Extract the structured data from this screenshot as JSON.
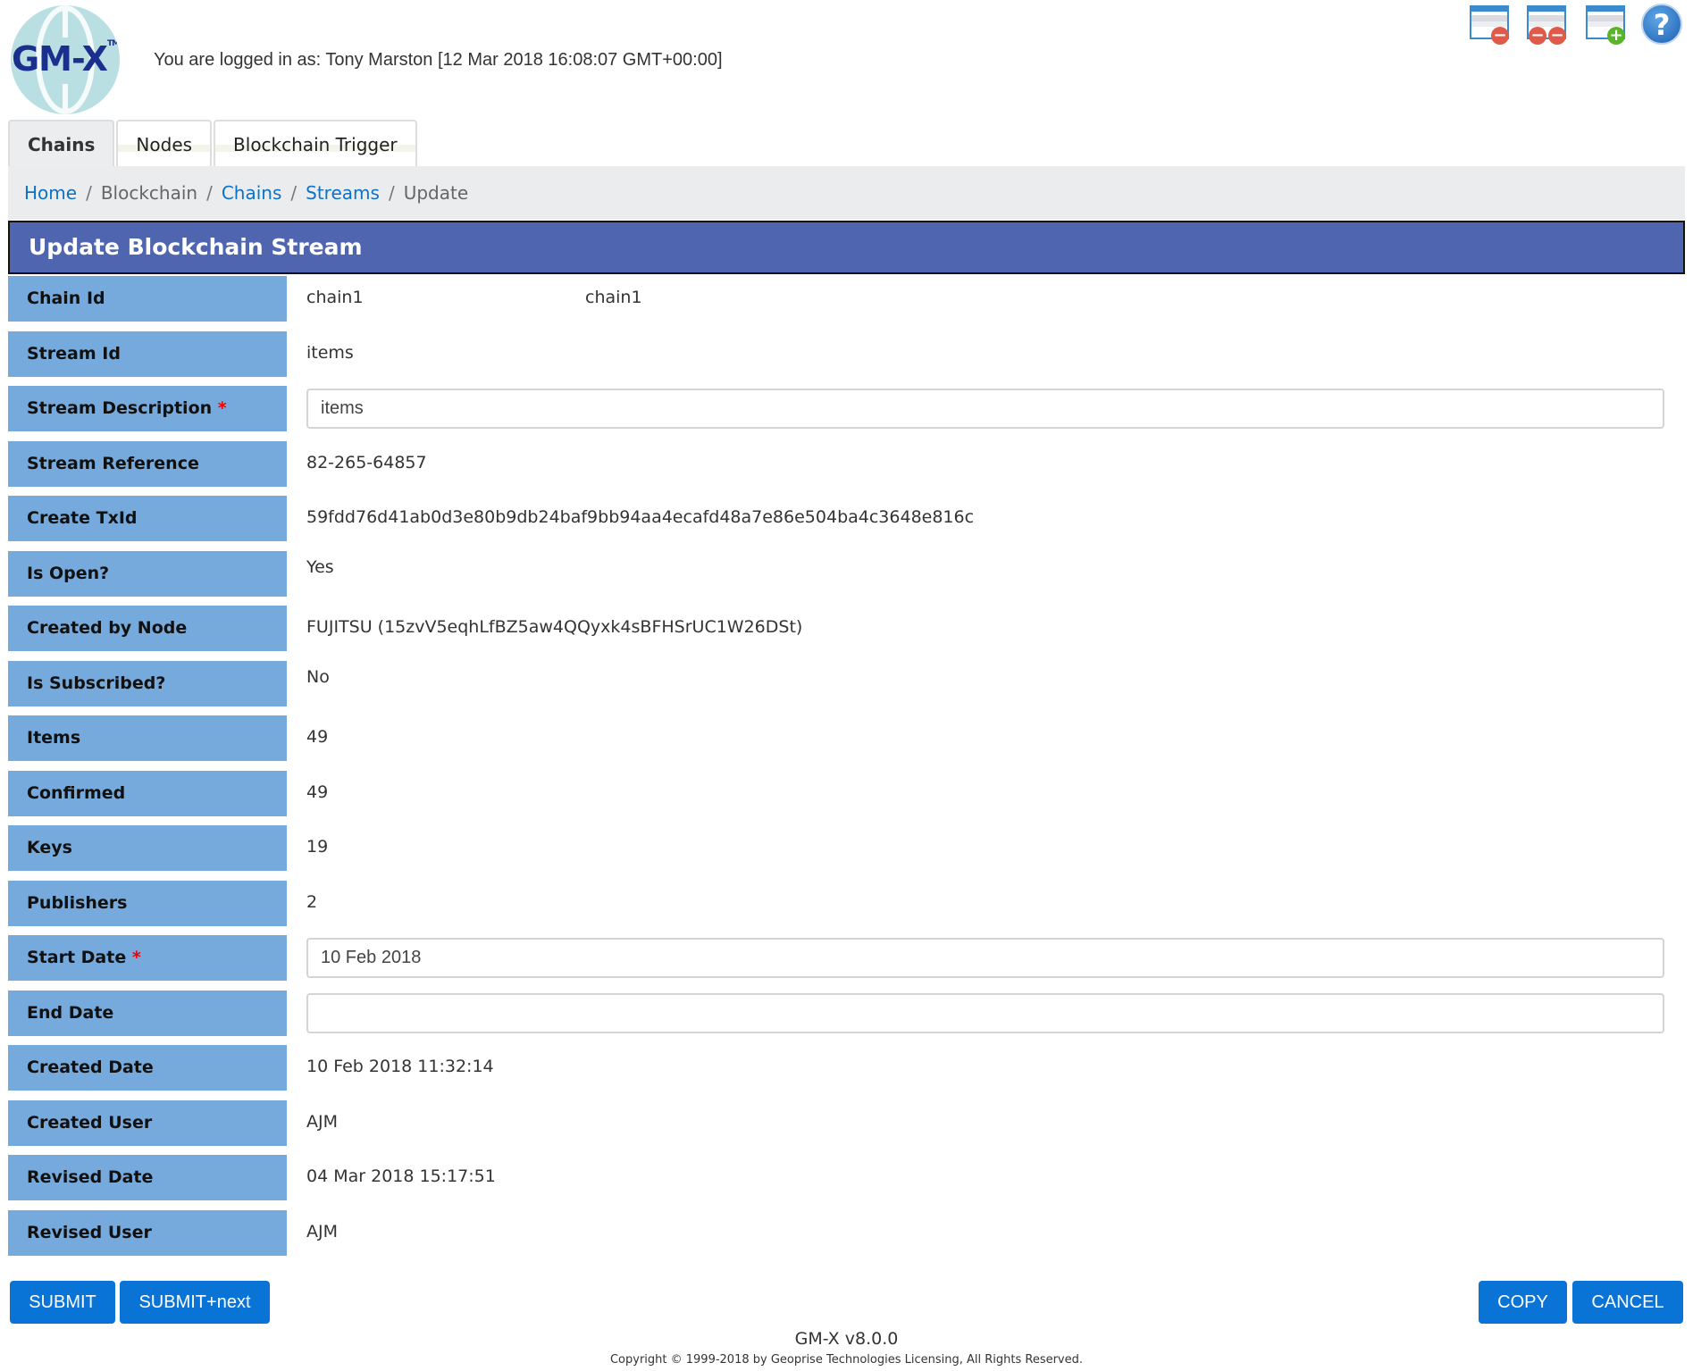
{
  "header": {
    "logo_text": "GM-X",
    "logo_tm": "TM",
    "login_text": "You are logged in as: Tony Marston [12 Mar 2018 16:08:07 GMT+00:00]",
    "icons": [
      {
        "name": "close-window-icon",
        "title": "Close"
      },
      {
        "name": "close-all-windows-icon",
        "title": "Close All"
      },
      {
        "name": "new-window-icon",
        "title": "New Window"
      },
      {
        "name": "help-icon",
        "title": "Help"
      }
    ]
  },
  "tabs": [
    {
      "label": "Chains",
      "active": true
    },
    {
      "label": "Nodes",
      "active": false
    },
    {
      "label": "Blockchain Trigger",
      "active": false
    }
  ],
  "breadcrumb": [
    {
      "label": "Home",
      "link": true
    },
    {
      "label": "Blockchain",
      "link": false
    },
    {
      "label": "Chains",
      "link": true
    },
    {
      "label": "Streams",
      "link": true
    },
    {
      "label": "Update",
      "link": false
    }
  ],
  "breadcrumb_sep": "/",
  "form": {
    "title": "Update Blockchain Stream",
    "required_mark": "*",
    "fields": [
      {
        "label": "Chain Id",
        "value": "chain1",
        "value2": "chain1"
      },
      {
        "label": "Stream Id",
        "value": "items"
      },
      {
        "label": "Stream Description",
        "value": "items",
        "input": true,
        "required": true
      },
      {
        "label": "Stream Reference",
        "value": "82-265-64857"
      },
      {
        "label": "Create TxId",
        "value": "59fdd76d41ab0d3e80b9db24baf9bb94aa4ecafd48a7e86e504ba4c3648e816c"
      },
      {
        "label": "Is Open?",
        "value": "Yes"
      },
      {
        "label": "Created by Node",
        "value": "FUJITSU (15zvV5eqhLfBZ5aw4QQyxk4sBFHSrUC1W26DSt)"
      },
      {
        "label": "Is Subscribed?",
        "value": "No"
      },
      {
        "label": "Items",
        "value": "49"
      },
      {
        "label": "Confirmed",
        "value": "49"
      },
      {
        "label": "Keys",
        "value": "19"
      },
      {
        "label": "Publishers",
        "value": "2"
      },
      {
        "label": "Start Date",
        "value": "10 Feb 2018",
        "input": true,
        "required": true
      },
      {
        "label": "End Date",
        "value": "",
        "input": true
      },
      {
        "label": "Created Date",
        "value": "10 Feb 2018 11:32:14"
      },
      {
        "label": "Created User",
        "value": "AJM"
      },
      {
        "label": "Revised Date",
        "value": "04 Mar 2018 15:17:51"
      },
      {
        "label": "Revised User",
        "value": "AJM"
      }
    ]
  },
  "buttons": {
    "submit": "SUBMIT",
    "submit_next": "SUBMIT+next",
    "copy": "COPY",
    "cancel": "CANCEL"
  },
  "footer": {
    "version": "GM-X v8.0.0",
    "copyright": "Copyright © 1999-2018 by Geoprise Technologies Licensing, All Rights Reserved."
  },
  "colors": {
    "title_bar": "#4f65b0",
    "label_bg": "#77aadc",
    "button": "#0a73d6",
    "link": "#0b72c8",
    "required": "#ee0000"
  }
}
